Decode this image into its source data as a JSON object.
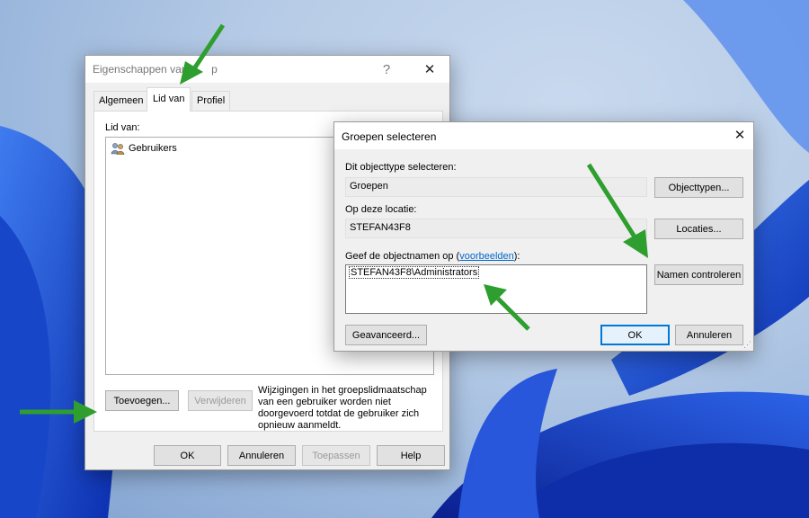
{
  "colors": {
    "accent": "#0078d7",
    "arrow": "#2e9e2e",
    "wallpaper_blue": "#1e4fd6"
  },
  "props_dialog": {
    "title": "Eigenschappen van",
    "title_suffix": "p",
    "help_glyph": "?",
    "close_glyph": "✕",
    "tabs": [
      "Algemeen",
      "Lid van",
      "Profiel"
    ],
    "member_of_label": "Lid van:",
    "members": [
      {
        "name": "Gebruikers",
        "icon": "group-icon"
      }
    ],
    "add_button": "Toevoegen...",
    "remove_button": "Verwijderen",
    "notice": "Wijzigingen in het groepslidmaatschap van een gebruiker worden niet doorgevoerd totdat de gebruiker zich opnieuw aanmeldt.",
    "footer_buttons": [
      "OK",
      "Annuleren",
      "Toepassen",
      "Help"
    ]
  },
  "select_dialog": {
    "title": "Groepen selecteren",
    "close_glyph": "✕",
    "object_type_label": "Dit objecttype selecteren:",
    "object_type_value": "Groepen",
    "object_types_button": "Objecttypen...",
    "location_label": "Op deze locatie:",
    "location_value": "STEFAN43F8",
    "locations_button": "Locaties...",
    "names_label_prefix": "Geef de objectnamen op (",
    "names_label_link": "voorbeelden",
    "names_label_suffix": "):",
    "names_value": "STEFAN43F8\\Administrators",
    "check_names_button": "Namen controleren",
    "advanced_button": "Geavanceerd...",
    "ok_button": "OK",
    "cancel_button": "Annuleren"
  }
}
